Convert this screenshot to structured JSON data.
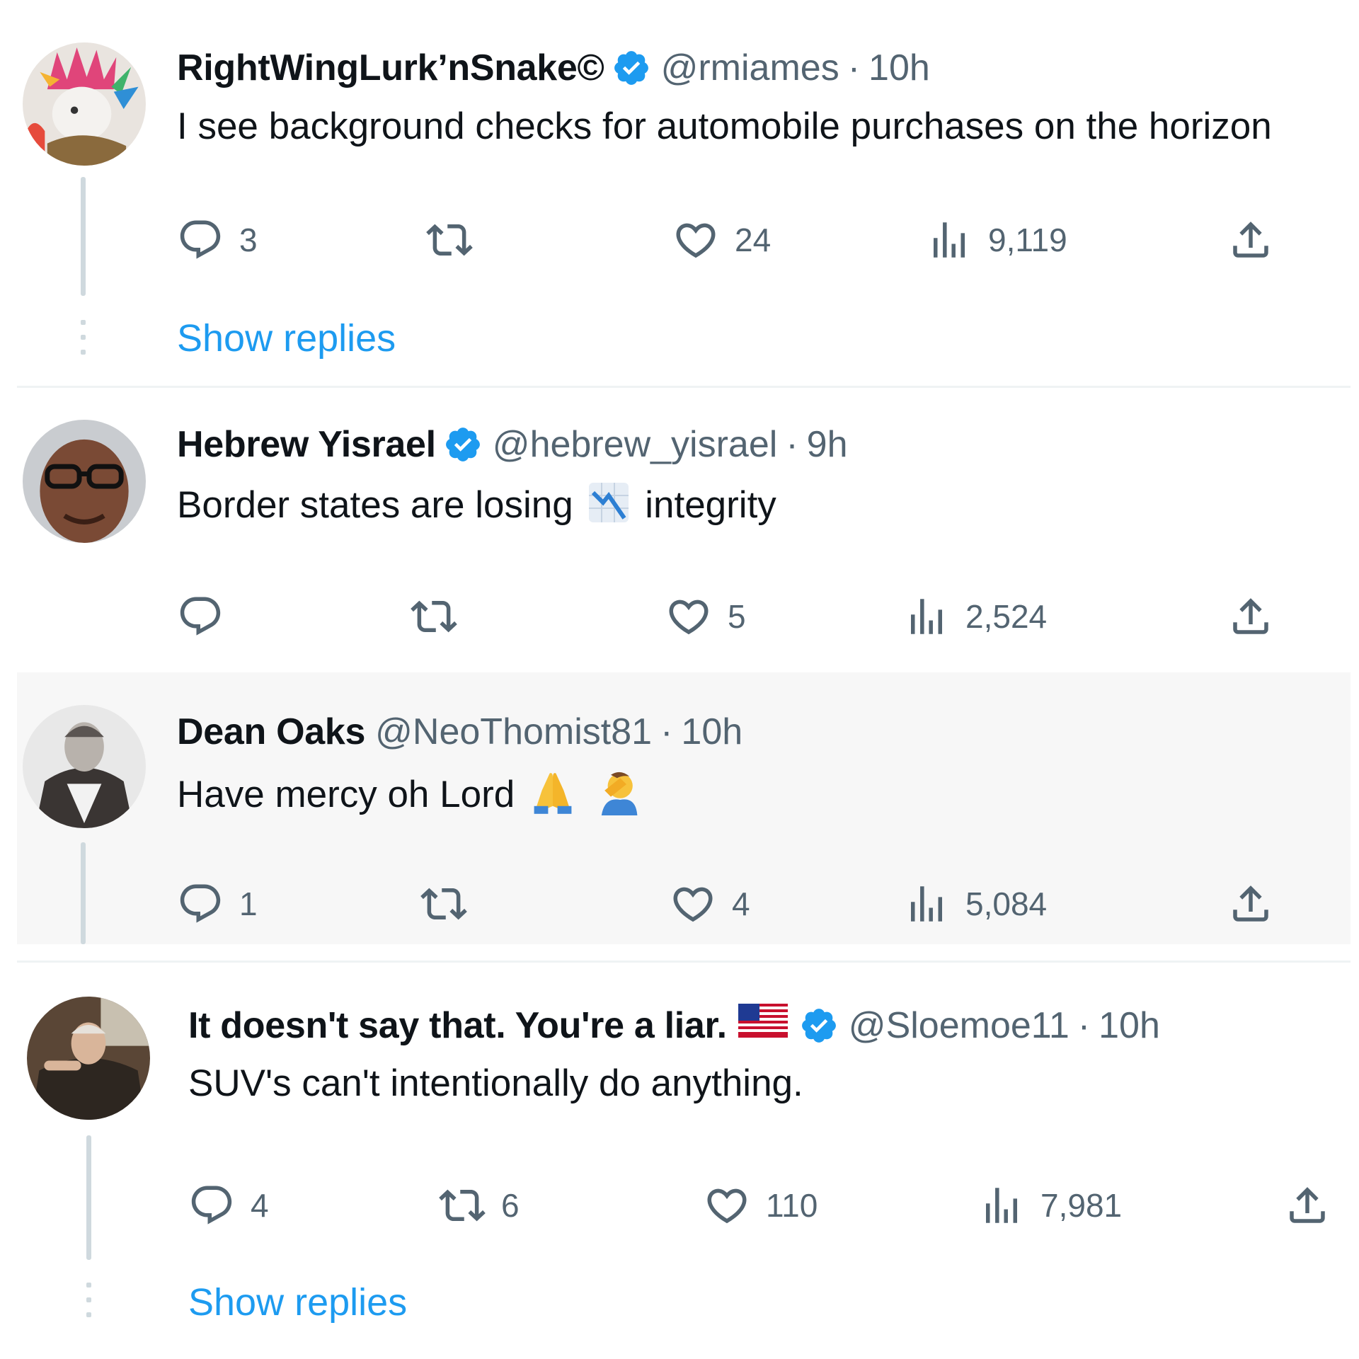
{
  "colors": {
    "accent": "#1d9bf0",
    "text": "#0f1419",
    "muted": "#536471",
    "verified": "#1d9bf0",
    "highlight_bg": "#f7f7f7"
  },
  "tweets": [
    {
      "name": "RightWingLurk’nSnake©",
      "verified": true,
      "handle": "@rmiames",
      "time": "10h",
      "text": "I see background checks for automobile purchases on the horizon",
      "replies": "3",
      "reposts": "",
      "likes": "24",
      "views": "9,119",
      "show_replies": "Show replies"
    },
    {
      "name": "Hebrew Yisrael",
      "verified": true,
      "handle": "@hebrew_yisrael",
      "time": "9h",
      "text_before": "Border states are losing",
      "emoji": "chart-decreasing-emoji",
      "text_after": "integrity",
      "replies": "",
      "reposts": "",
      "likes": "5",
      "views": "2,524"
    },
    {
      "name": "Dean Oaks",
      "verified": false,
      "handle": "@NeoThomist81",
      "time": "10h",
      "text": "Have mercy oh Lord",
      "emojis": [
        "folded-hands-emoji",
        "facepalm-emoji"
      ],
      "replies": "1",
      "reposts": "",
      "likes": "4",
      "views": "5,084"
    },
    {
      "name": "It doesn't say that. You're a liar.",
      "name_emoji": "us-flag-emoji",
      "verified": true,
      "handle": "@Sloemoe11",
      "time": "10h",
      "text": "SUV's can't intentionally do anything.",
      "replies": "4",
      "reposts": "6",
      "likes": "110",
      "views": "7,981",
      "show_replies": "Show replies"
    }
  ],
  "separator_dot": "·"
}
